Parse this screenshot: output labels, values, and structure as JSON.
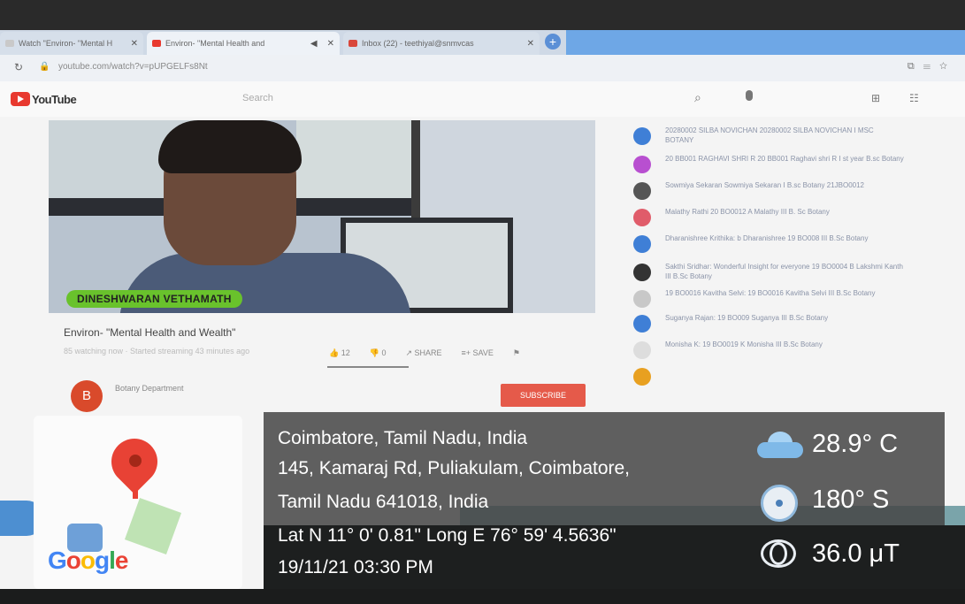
{
  "browser": {
    "tabs": [
      {
        "label": "Watch \"Environ- \"Mental H",
        "fav_color": "#c9c9c9"
      },
      {
        "label": "Environ- \"Mental Health and",
        "fav_color": "#e8392f"
      },
      {
        "label": "Inbox (22) - teethiyal@snmvcas",
        "fav_color": "#d9473b"
      }
    ],
    "url": "youtube.com/watch?v=pUPGELFs8Nt"
  },
  "youtube": {
    "logo": "YouTube",
    "search_placeholder": "Search"
  },
  "video": {
    "speaker_name": "DINESHWARAN VETHAMATH",
    "title": "Environ- \"Mental Health and Wealth\"",
    "meta": "85 watching now · Started streaming 43 minutes ago",
    "likes": "12",
    "dislikes": "0",
    "share_label": "SHARE",
    "save_label": "SAVE",
    "channel_initial": "B",
    "channel_name": "Botany Department",
    "subscribe_label": "SUBSCRIBE"
  },
  "chat": [
    {
      "text": "20280002 SILBA NOVICHAN 20280002 SILBA NOVICHAN I MSC BOTANY",
      "color": "#3f7fd6"
    },
    {
      "text": "20 BB001 RAGHAVI SHRI R 20 BB001 Raghavi shri R I st year B.sc Botany",
      "color": "#b84fd0"
    },
    {
      "text": "Sowmiya Sekaran Sowmiya Sekaran I B.sc Botany 21JBO0012",
      "color": "#555555"
    },
    {
      "text": "Malathy Rathi 20 BO0012 A Malathy III B. Sc Botany",
      "color": "#e05c6a"
    },
    {
      "text": "Dharanishree Krithika: b Dharanishree 19 BO008 III B.Sc Botany",
      "color": "#3f7fd6"
    },
    {
      "text": "Sakthi Sridhar: Wonderful Insight for everyone 19 BO0004 B Lakshmi Kanth III B.Sc Botany",
      "color": "#333333"
    },
    {
      "text": "19 BO0016 Kavitha Selvi: 19 BO0016 Kavitha Selvi III B.Sc Botany",
      "color": "#c8c8c8"
    },
    {
      "text": "Suganya Rajan: 19 BO009 Suganya III B.Sc Botany",
      "color": "#3f7fd6"
    },
    {
      "text": "Monisha K: 19 BO0019 K Monisha III B.Sc Botany",
      "color": "#dddddd"
    },
    {
      "text": "",
      "color": "#e8a020"
    }
  ],
  "overlay": {
    "location_title": "Coimbatore, Tamil Nadu, India",
    "address_line1": "145, Kamaraj Rd, Puliakulam, Coimbatore,",
    "address_line2": "Tamil Nadu 641018, India",
    "coordinates": "Lat N 11° 0' 0.81\" Long E 76° 59' 4.5636\"",
    "datetime": "19/11/21 03:30 PM",
    "temperature": "28.9° C",
    "heading": "180° S",
    "magnetic": "36.0 μT",
    "map_logo": "Google"
  }
}
